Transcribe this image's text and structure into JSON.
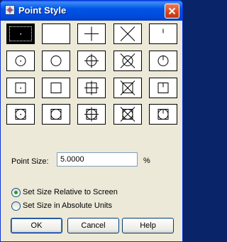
{
  "window": {
    "title": "Point Style",
    "title_icon": "point-style-app-icon",
    "close_icon": "close-icon"
  },
  "point_styles": {
    "rows": 4,
    "columns": 5,
    "selected_index": 0,
    "modes": [
      "dot",
      "none",
      "plus",
      "x",
      "tick"
    ],
    "row_decorations": [
      "none",
      "circle",
      "square",
      "circle+square"
    ]
  },
  "point_size": {
    "label": "Point Size:",
    "value": "5.0000",
    "unit": "%"
  },
  "size_mode": {
    "options": [
      {
        "label": "Set Size Relative to Screen",
        "selected": true
      },
      {
        "label": "Set Size in Absolute Units",
        "selected": false
      }
    ]
  },
  "buttons": {
    "ok": "OK",
    "cancel": "Cancel",
    "help": "Help"
  }
}
